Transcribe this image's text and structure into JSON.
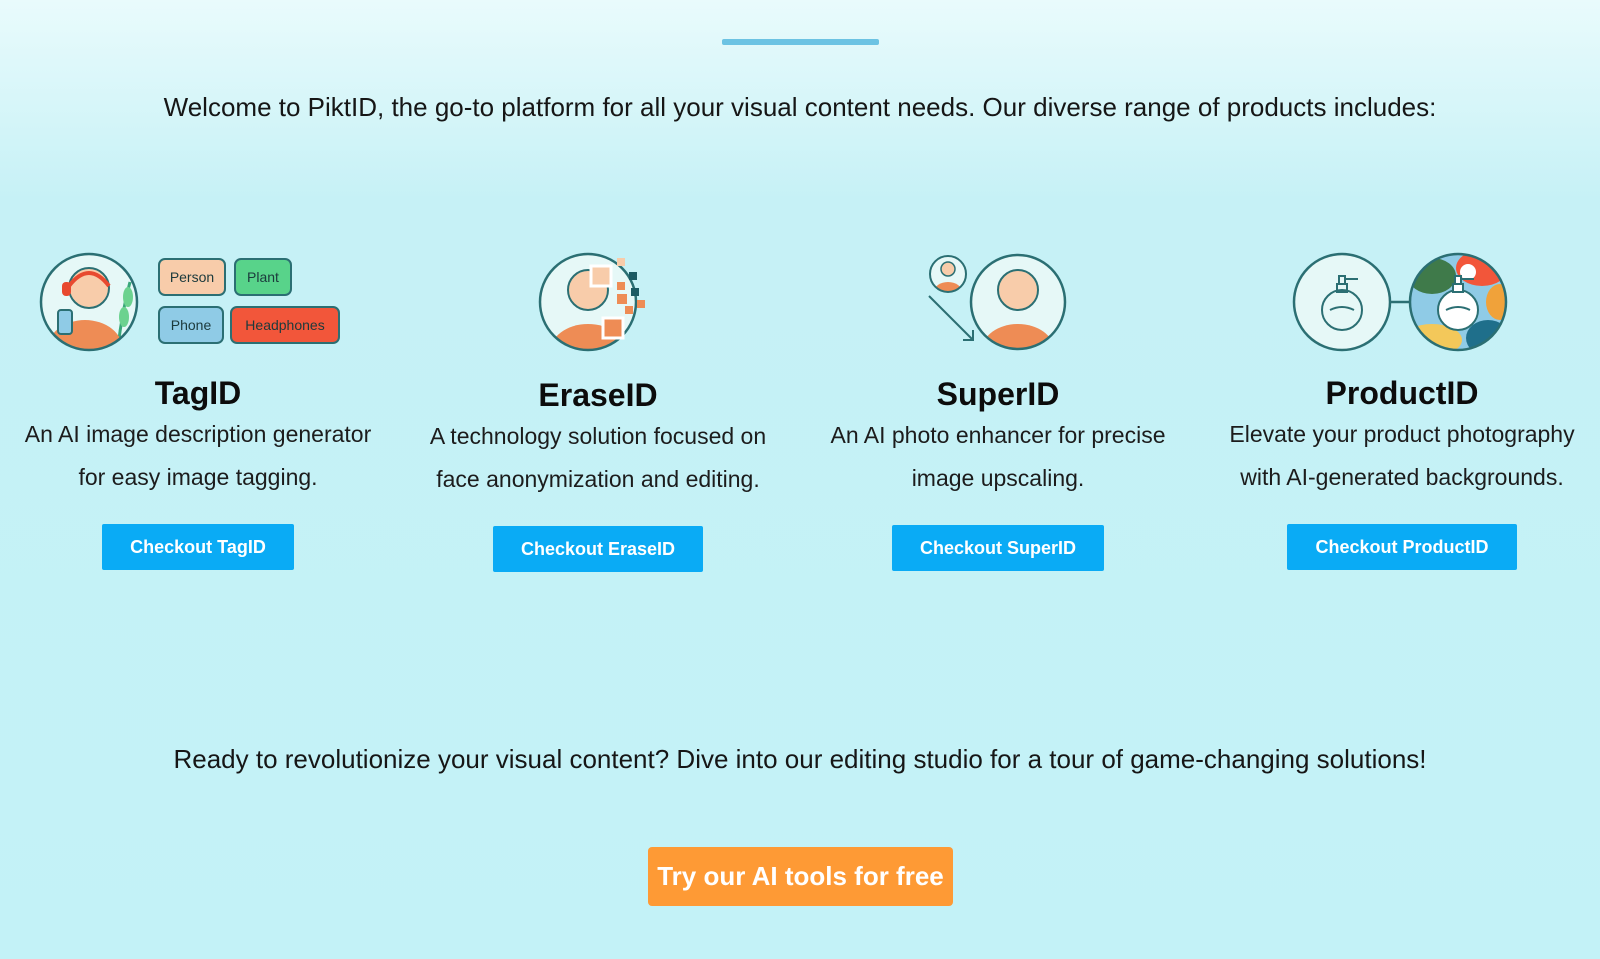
{
  "intro": "Welcome to PiktID, the go-to platform for all your visual content needs. Our diverse range of products includes:",
  "products": [
    {
      "name": "TagID",
      "description_line1": "An AI image description generator",
      "description_line2": "for easy image tagging.",
      "button": "Checkout TagID",
      "tags": [
        "Person",
        "Plant",
        "Phone",
        "Headphones"
      ]
    },
    {
      "name": "EraseID",
      "description_line1": "A technology solution focused on",
      "description_line2": "face anonymization and editing.",
      "button": "Checkout EraseID"
    },
    {
      "name": "SuperID",
      "description_line1": "An AI photo enhancer for precise",
      "description_line2": "image upscaling.",
      "button": "Checkout SuperID"
    },
    {
      "name": "ProductID",
      "description_line1": "Elevate your product photography",
      "description_line2": "with AI-generated backgrounds.",
      "button": "Checkout ProductID"
    }
  ],
  "closing": "Ready to revolutionize your visual content? Dive into our editing studio for a tour of game-changing solutions!",
  "cta": "Try our AI tools for free",
  "colors": {
    "accent_blue": "#0aabf5",
    "cta_orange": "#fe9a35",
    "divider": "#6cc3e3",
    "outline": "#2b6f73",
    "skin": "#f8ccaa",
    "shirt": "#ee8c55"
  }
}
